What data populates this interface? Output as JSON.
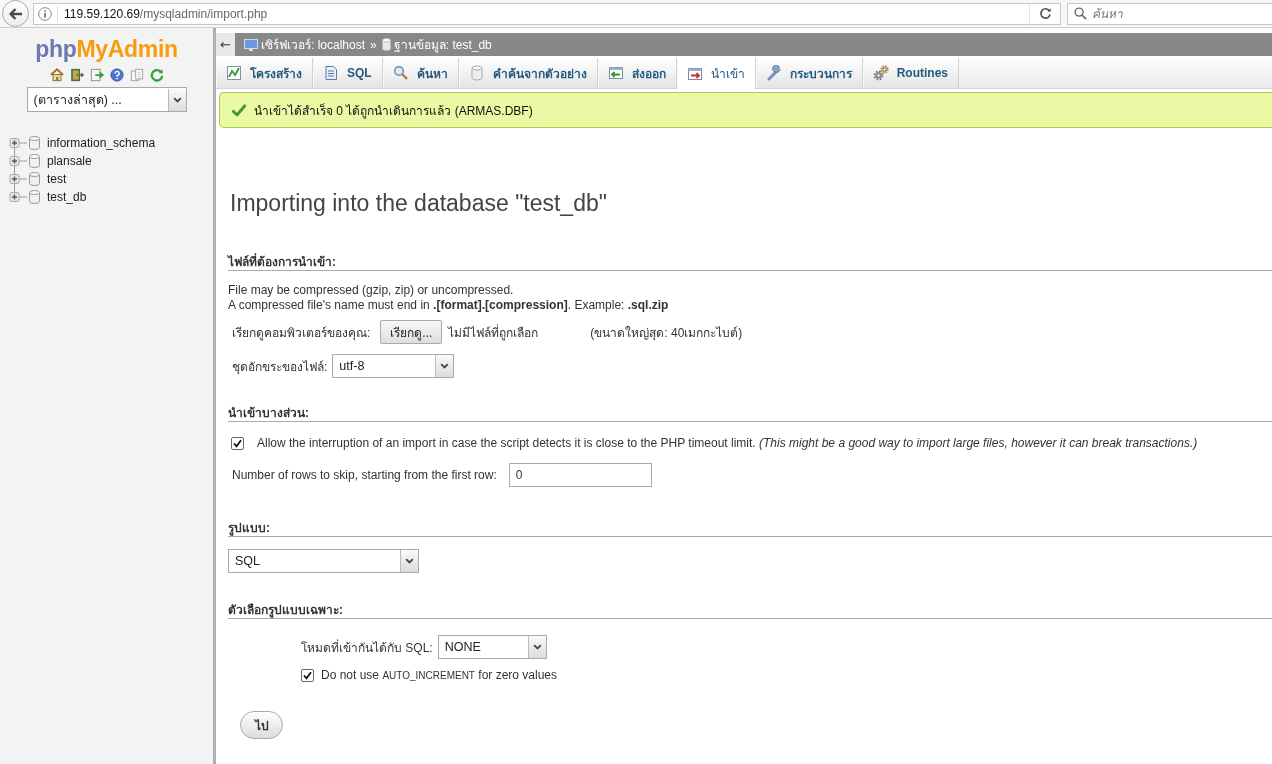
{
  "browser": {
    "url_host": "119.59.120.69",
    "url_path": "/mysqladmin/import.php",
    "search_placeholder": "ค้นหา"
  },
  "sidebar": {
    "logo": {
      "first": "php",
      "second": "MyAdmin"
    },
    "recent_tables": "(ตารางล่าสุด) ...",
    "databases": [
      {
        "name": "information_schema",
        "expanded": false
      },
      {
        "name": "plansale",
        "expanded": false
      },
      {
        "name": "test",
        "expanded": false
      },
      {
        "name": "test_db",
        "expanded": false
      }
    ]
  },
  "breadcrumb": {
    "collapse_button": "←",
    "separator": "»",
    "items": [
      {
        "kind": "server",
        "label": "เซิร์ฟเวอร์: localhost"
      },
      {
        "kind": "database",
        "label": "ฐานข้อมูล: test_db"
      }
    ]
  },
  "tabs": [
    {
      "kind": "structure",
      "label": "โครงสร้าง",
      "selected": false
    },
    {
      "kind": "sql",
      "label": "SQL",
      "selected": false
    },
    {
      "kind": "search",
      "label": "ค้นหา",
      "selected": false
    },
    {
      "kind": "query",
      "label": "คำค้นจากตัวอย่าง",
      "selected": false
    },
    {
      "kind": "export",
      "label": "ส่งออก",
      "selected": false
    },
    {
      "kind": "import",
      "label": "นำเข้า",
      "selected": true
    },
    {
      "kind": "operations",
      "label": "กระบวนการ",
      "selected": false
    },
    {
      "kind": "routines",
      "label": "Routines",
      "selected": false
    }
  ],
  "message": {
    "kind": "success",
    "text": "นำเข้าได้สำเร็จ 0 ได้ถูกนำเดินการแล้ว (ARMAS.DBF)"
  },
  "title": "Importing into the database \"test_db\"",
  "file_section": {
    "heading": "ไฟล์ที่ต้องการนำเข้า:",
    "notes": [
      "File may be compressed (gzip, zip) or uncompressed.",
      "A compressed file's name must end in **.[format].[compression]**. Example: **.sql.zip**"
    ],
    "browse_label": "เรียกดูคอมพิวเตอร์ของคุณ:",
    "browse_button": "เรียกดู...",
    "no_file": "ไม่มีไฟล์ที่ถูกเลือก",
    "max_size": "(ขนาดใหญ่สุด: 40เมกกะไบต์)",
    "charset_label": "ชุดอักขระของไฟล์:",
    "charset": "utf-8"
  },
  "partial_section": {
    "heading": "นำเข้าบางส่วน:",
    "allow_interrupt": {
      "checked": true,
      "text": "Allow the interruption of an import in case the script detects it is close to the PHP timeout limit. *(This might be a good way to import large files, however it can break transactions.)*"
    },
    "skip_label": "Number of rows to skip, starting from the first row:",
    "skip_value": "0"
  },
  "format_section": {
    "heading": "รูปแบบ:",
    "format": "SQL"
  },
  "options_section": {
    "heading": "ตัวเลือกรูปแบบเฉพาะ:",
    "compat_label": "โหมดที่เข้ากันได้กับ SQL:",
    "compat_value": "NONE",
    "no_auto_increment": {
      "checked": true,
      "before": "Do not use",
      "keyword": "AUTO_INCREMENT",
      "after": "for zero values"
    }
  },
  "go_button": "ไป"
}
